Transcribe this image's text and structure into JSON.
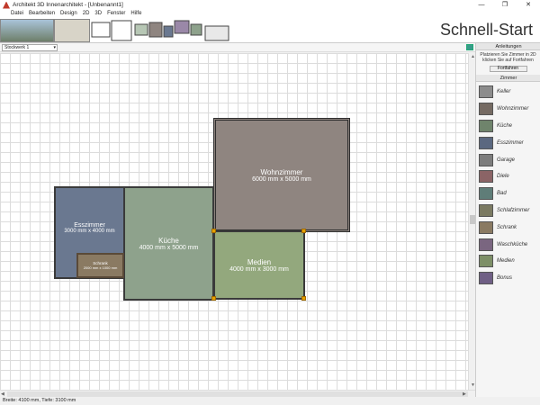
{
  "window": {
    "title": "Architekt 3D Innenarchitekt - [Unbenannt1]",
    "minimize": "—",
    "maximize": "❐",
    "close": "✕"
  },
  "menu": [
    "Datei",
    "Bearbeiten",
    "Design",
    "2D",
    "3D",
    "Fenster",
    "Hilfe"
  ],
  "ribbon": {
    "quickstart_label": "Schnell-Start"
  },
  "floor_selector": {
    "value": "Stockwerk 1"
  },
  "canvas": {
    "rooms": [
      {
        "name": "Wohnzimmer",
        "size": "6000 mm x 5000 mm",
        "color": "#8f8580"
      },
      {
        "name": "Esszimmer",
        "size": "3000 mm x 4000 mm",
        "color": "#6a7890"
      },
      {
        "name": "Küche",
        "size": "4000 mm x 5000 mm",
        "color": "#8ea28c"
      },
      {
        "name": "Medien",
        "size": "4000 mm x 3000 mm",
        "color": "#93a87d"
      },
      {
        "name": "Schrank",
        "size": "2000 mm x 1000 mm",
        "color": "#8a7a62"
      }
    ]
  },
  "sidebar": {
    "instructions_header": "Anleitungen",
    "instructions_text": "Platzieren Sie Zimmer in 2D  klicken Sie auf Fortfahren",
    "continue_button": "Fortfahren",
    "rooms_header": "Zimmer",
    "room_types": [
      {
        "label": "Keller",
        "color": "#8c8c8c"
      },
      {
        "label": "Wohnzimmer",
        "color": "#756a62"
      },
      {
        "label": "Küche",
        "color": "#6f846c"
      },
      {
        "label": "Esszimmer",
        "color": "#5b6880"
      },
      {
        "label": "Garage",
        "color": "#7d7d7d"
      },
      {
        "label": "Diele",
        "color": "#8b6466"
      },
      {
        "label": "Bad",
        "color": "#5f7d78"
      },
      {
        "label": "Schlafzimmer",
        "color": "#7b7a62"
      },
      {
        "label": "Schrank",
        "color": "#8a7a62"
      },
      {
        "label": "Waschküche",
        "color": "#7a6680"
      },
      {
        "label": "Medien",
        "color": "#7d8f67"
      },
      {
        "label": "Bonus",
        "color": "#6f5f85"
      }
    ]
  },
  "status": {
    "text": "Breite: 4100 mm, Tiefe: 3100 mm"
  }
}
